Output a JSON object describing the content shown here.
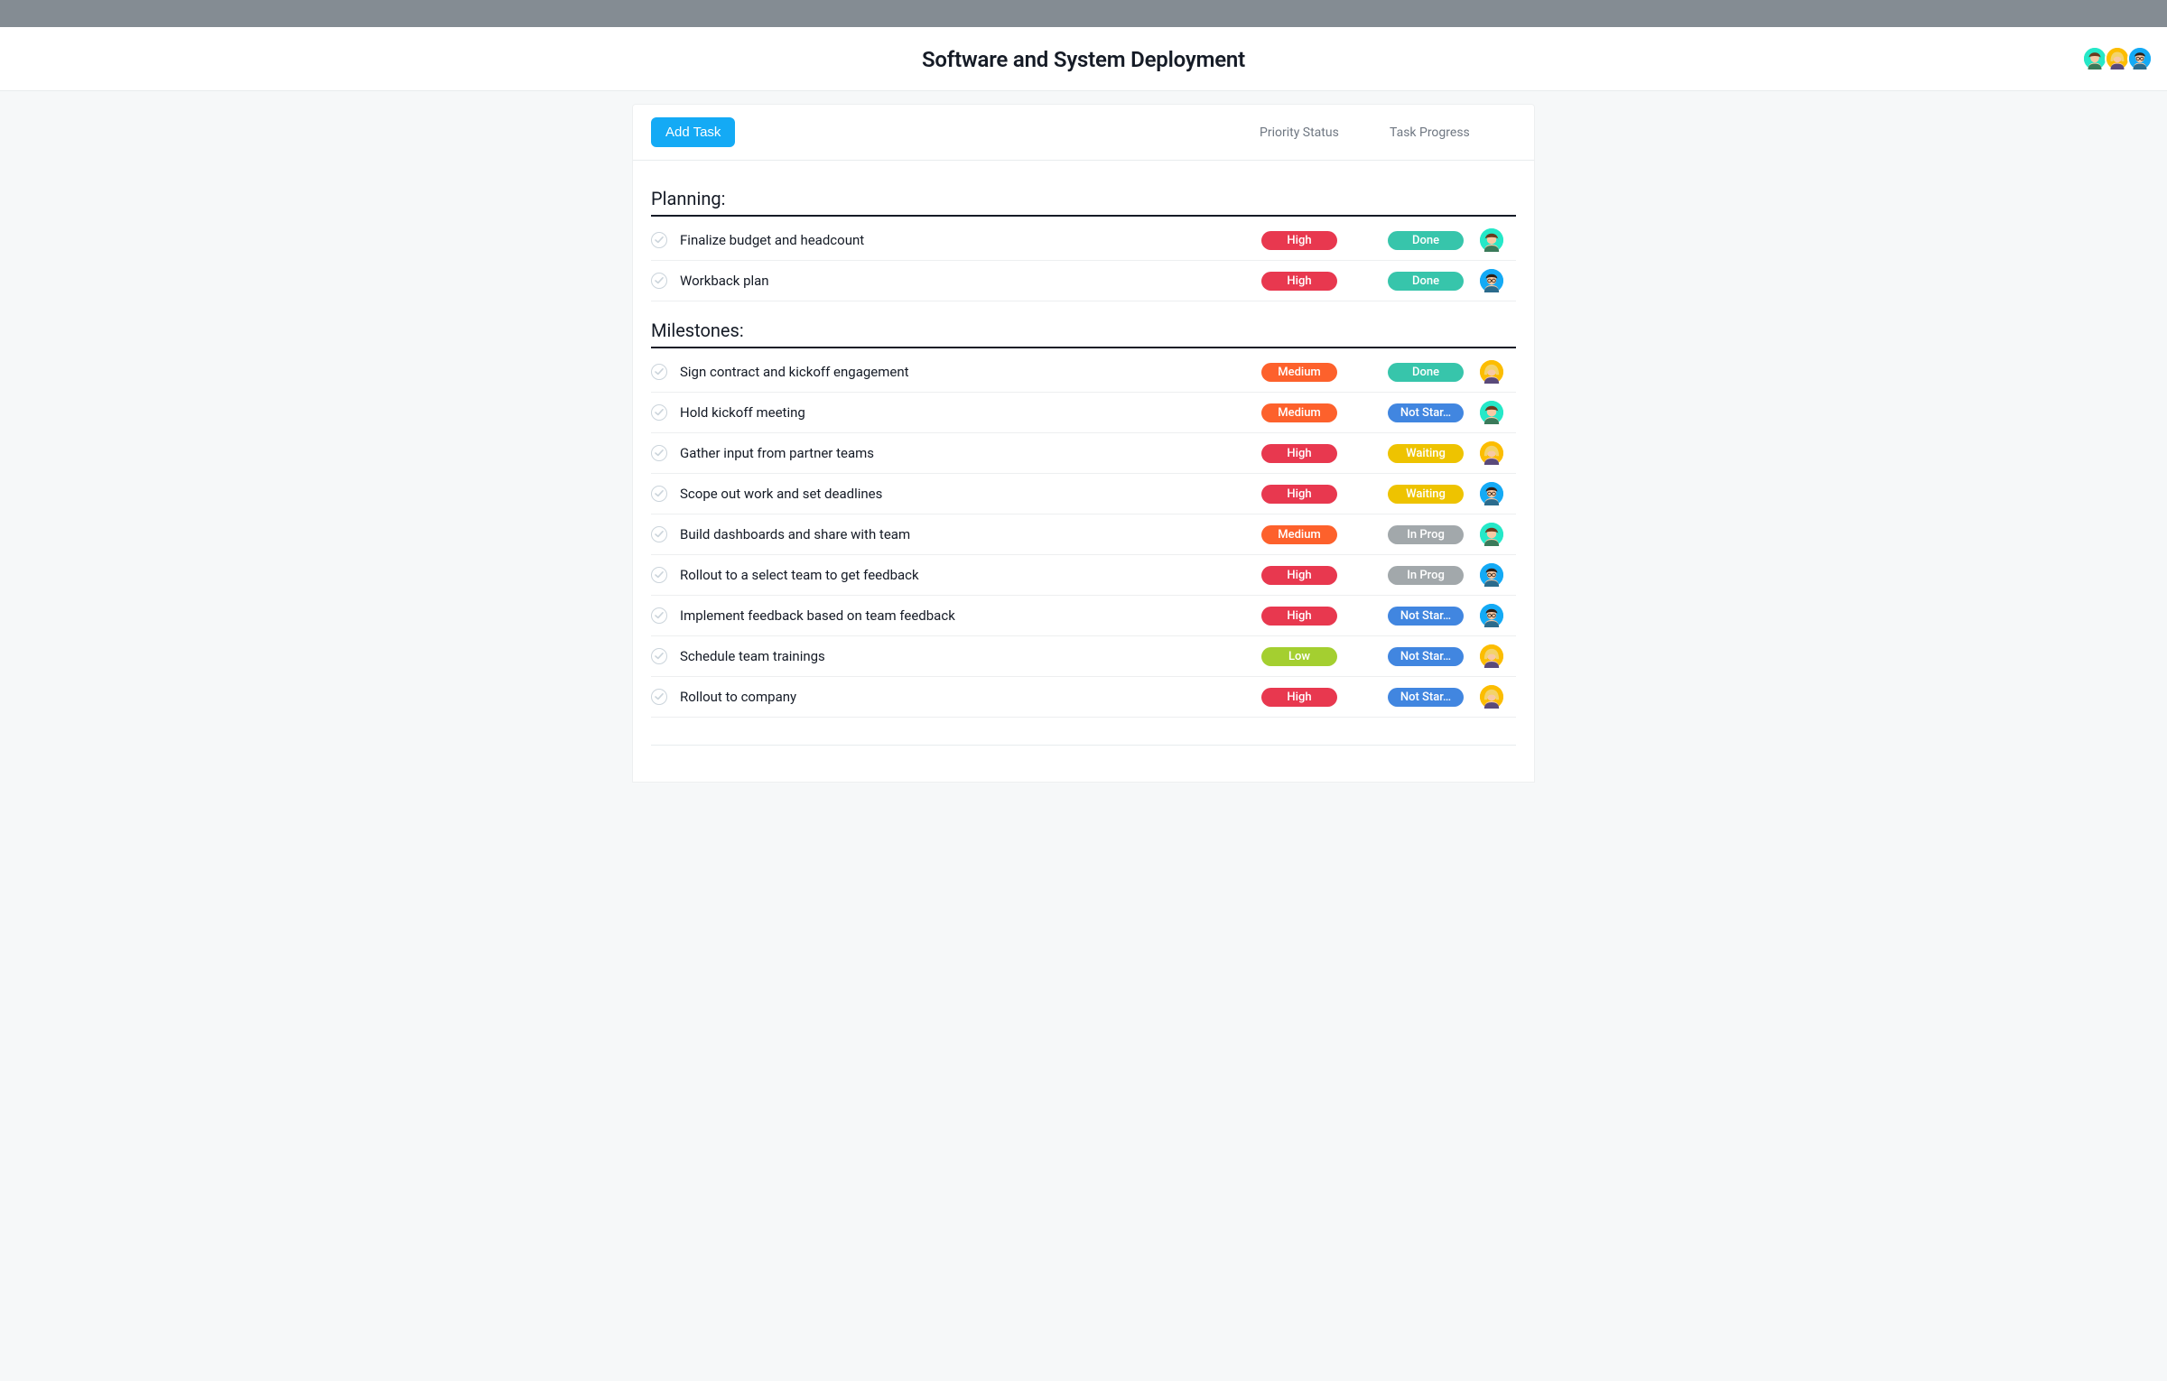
{
  "header": {
    "title": "Software and System Deployment"
  },
  "toolbar": {
    "add_task_label": "Add Task",
    "columns": {
      "priority": "Priority Status",
      "progress": "Task Progress"
    }
  },
  "avatars": {
    "a1": {
      "bg": "#25e8c8"
    },
    "a2": {
      "bg": "#fcbd01"
    },
    "a3": {
      "bg": "#14aaf5"
    }
  },
  "priority_colors": {
    "High": "#e8384f",
    "Medium": "#fd612c",
    "Low": "#a4cf30"
  },
  "progress_colors": {
    "Done": "#37c5ab",
    "Not Star…": "#4186e0",
    "Waiting": "#eec300",
    "In Prog": "#a2a8ab"
  },
  "sections": [
    {
      "title": "Planning:",
      "tasks": [
        {
          "name": "Finalize budget and headcount",
          "priority": "High",
          "progress": "Done",
          "assignee": "a1"
        },
        {
          "name": "Workback plan",
          "priority": "High",
          "progress": "Done",
          "assignee": "a3"
        }
      ]
    },
    {
      "title": "Milestones:",
      "tasks": [
        {
          "name": "Sign contract and kickoff engagement",
          "priority": "Medium",
          "progress": "Done",
          "assignee": "a2"
        },
        {
          "name": "Hold kickoff meeting",
          "priority": "Medium",
          "progress": "Not Star…",
          "assignee": "a1"
        },
        {
          "name": "Gather input from partner teams",
          "priority": "High",
          "progress": "Waiting",
          "assignee": "a2"
        },
        {
          "name": "Scope out work and set deadlines",
          "priority": "High",
          "progress": "Waiting",
          "assignee": "a3"
        },
        {
          "name": "Build dashboards and share with team",
          "priority": "Medium",
          "progress": "In Prog",
          "assignee": "a1"
        },
        {
          "name": "Rollout to a select team to get feedback",
          "priority": "High",
          "progress": "In Prog",
          "assignee": "a3"
        },
        {
          "name": "Implement feedback based on team feedback",
          "priority": "High",
          "progress": "Not Star…",
          "assignee": "a3"
        },
        {
          "name": "Schedule team trainings",
          "priority": "Low",
          "progress": "Not Star…",
          "assignee": "a2"
        },
        {
          "name": "Rollout to company",
          "priority": "High",
          "progress": "Not Star…",
          "assignee": "a2"
        }
      ]
    }
  ]
}
